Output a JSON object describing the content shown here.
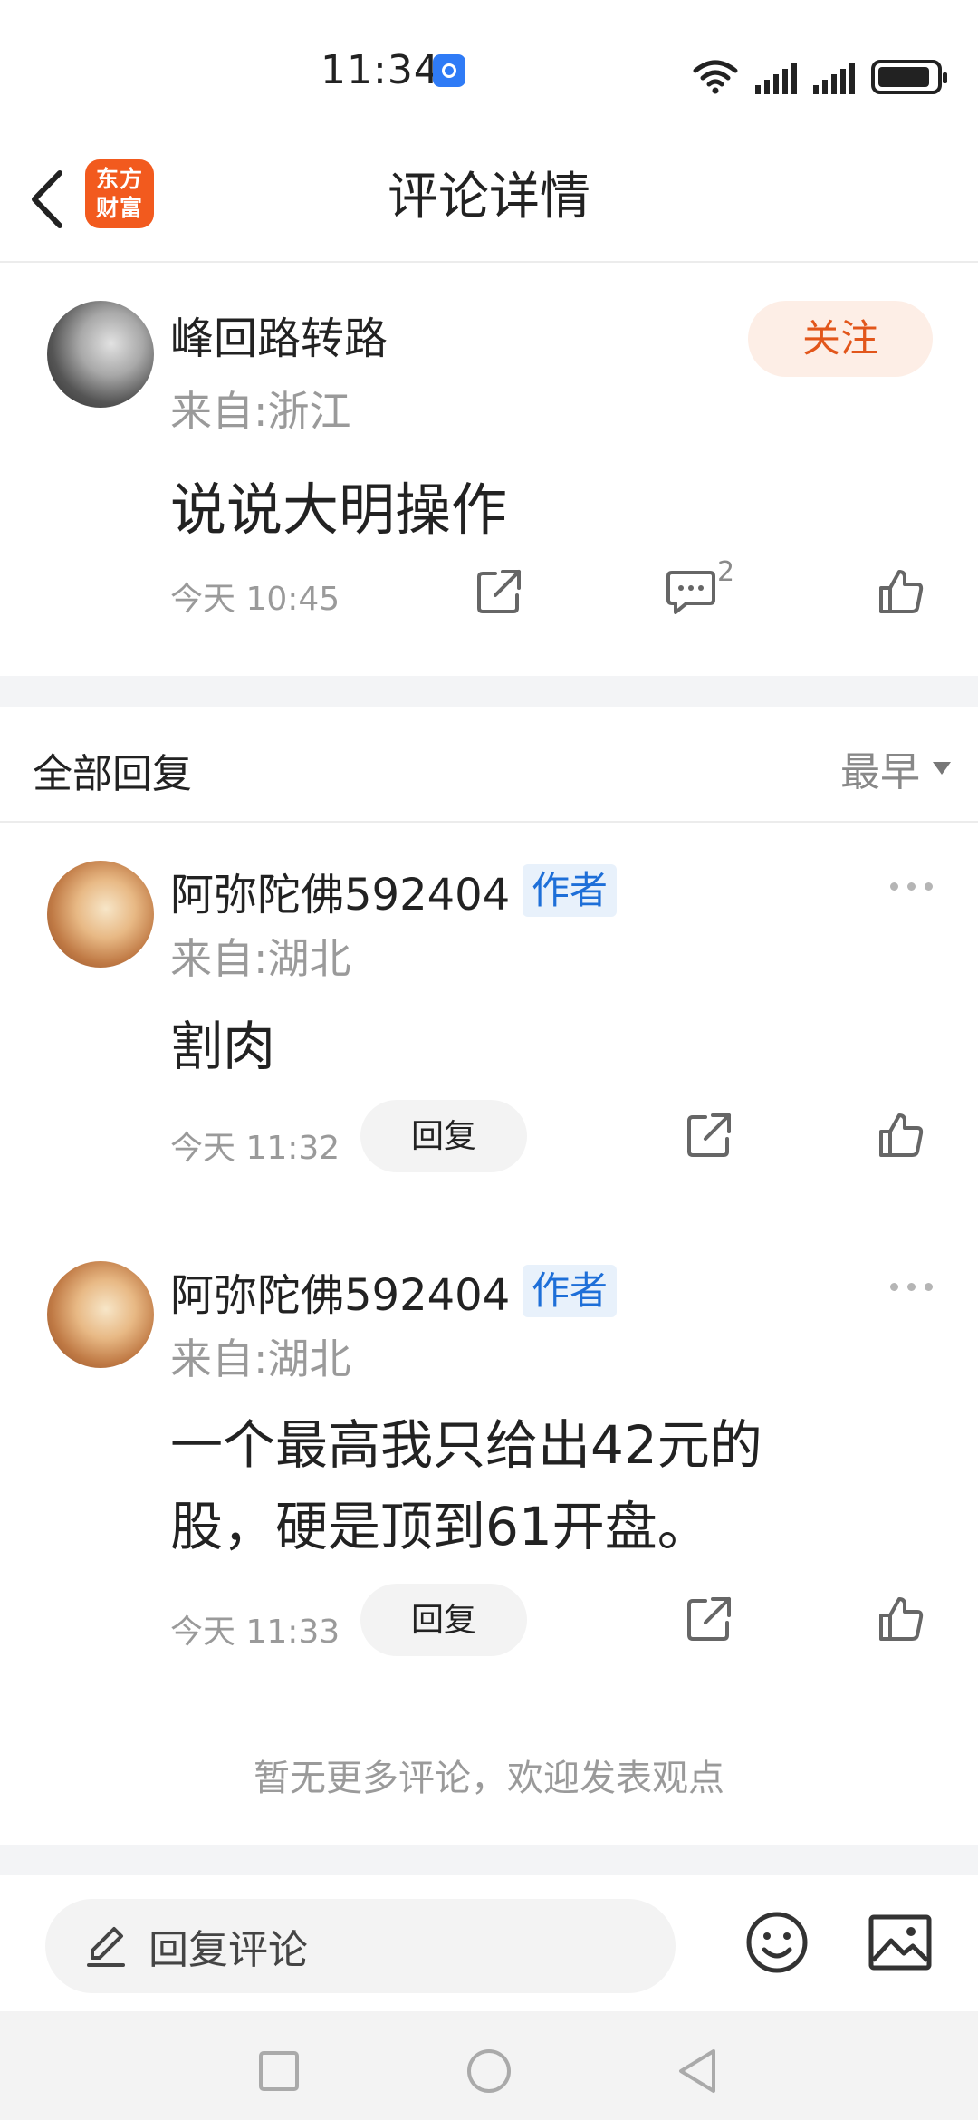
{
  "status_bar": {
    "time": "11:34"
  },
  "header": {
    "title": "评论详情",
    "logo_text_line1": "东方",
    "logo_text_line2": "财富"
  },
  "post": {
    "username": "峰回路转路",
    "location": "来自:浙江",
    "follow_label": "关注",
    "content": "说说大明操作",
    "time": "今天 10:45",
    "comment_count": "2"
  },
  "replies_section": {
    "title": "全部回复",
    "sort_label": "最早"
  },
  "replies": [
    {
      "username": "阿弥陀佛592404",
      "badge": "作者",
      "location": "来自:湖北",
      "content_lines": [
        "割肉"
      ],
      "time": "今天 11:32",
      "reply_label": "回复"
    },
    {
      "username": "阿弥陀佛592404",
      "badge": "作者",
      "location": "来自:湖北",
      "content_lines": [
        "一个最高我只给出42元的",
        "股，硬是顶到61开盘。"
      ],
      "time": "今天 11:33",
      "reply_label": "回复"
    }
  ],
  "footer_note": "暂无更多评论，欢迎发表观点",
  "bottom_bar": {
    "input_placeholder": "回复评论"
  },
  "colors": {
    "brand": "#f25a1e",
    "follow_text": "#e2561b",
    "badge_text": "#1e6fd8"
  },
  "icons": [
    "back-icon",
    "share-icon",
    "comment-icon",
    "like-icon",
    "more-icon",
    "edit-icon",
    "emoji-icon",
    "image-icon"
  ]
}
